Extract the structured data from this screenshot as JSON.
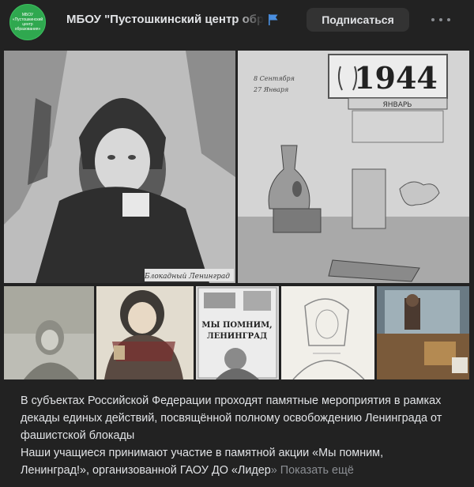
{
  "header": {
    "group_name": "МБОУ \"Пустошкинский центр образования\"",
    "avatar_text": "МБОУ «Пустошкинский центр образования»",
    "subscribe_label": "Подписаться",
    "flag_color": "#4a8fe0"
  },
  "photos": [
    {
      "id": "photo-1",
      "caption": "Блокадный Ленинград"
    },
    {
      "id": "photo-2",
      "calendar_year": "1944",
      "calendar_month": "ЯНВАРЬ",
      "calendar_note_1": "8 Сентября",
      "calendar_note_2": "27 Января"
    },
    {
      "id": "photo-3"
    },
    {
      "id": "photo-4"
    },
    {
      "id": "photo-5",
      "poster_title_1": "МЫ ПОМНИМ,",
      "poster_title_2": "ЛЕНИНГРАД"
    },
    {
      "id": "photo-6"
    },
    {
      "id": "photo-7"
    }
  ],
  "post": {
    "paragraph1": "В субъектах Российской Федерации проходят памятные мероприятия в рамках декады единых действий, посвящённой полному освобождению Ленинграда от фашистской блокады",
    "paragraph2_main": "Наши учащиеся принимают участие в памятной акции «Мы помним, Ленинград!», организованной ГАОУ ДО «Лидер",
    "paragraph2_fade": "»",
    "show_more_label": "Показать ещё"
  },
  "colors": {
    "background": "#222222",
    "text": "#e1e3e6",
    "secondary": "#8b8e93",
    "button_bg": "#333333",
    "avatar_green": "#2fa84f"
  }
}
